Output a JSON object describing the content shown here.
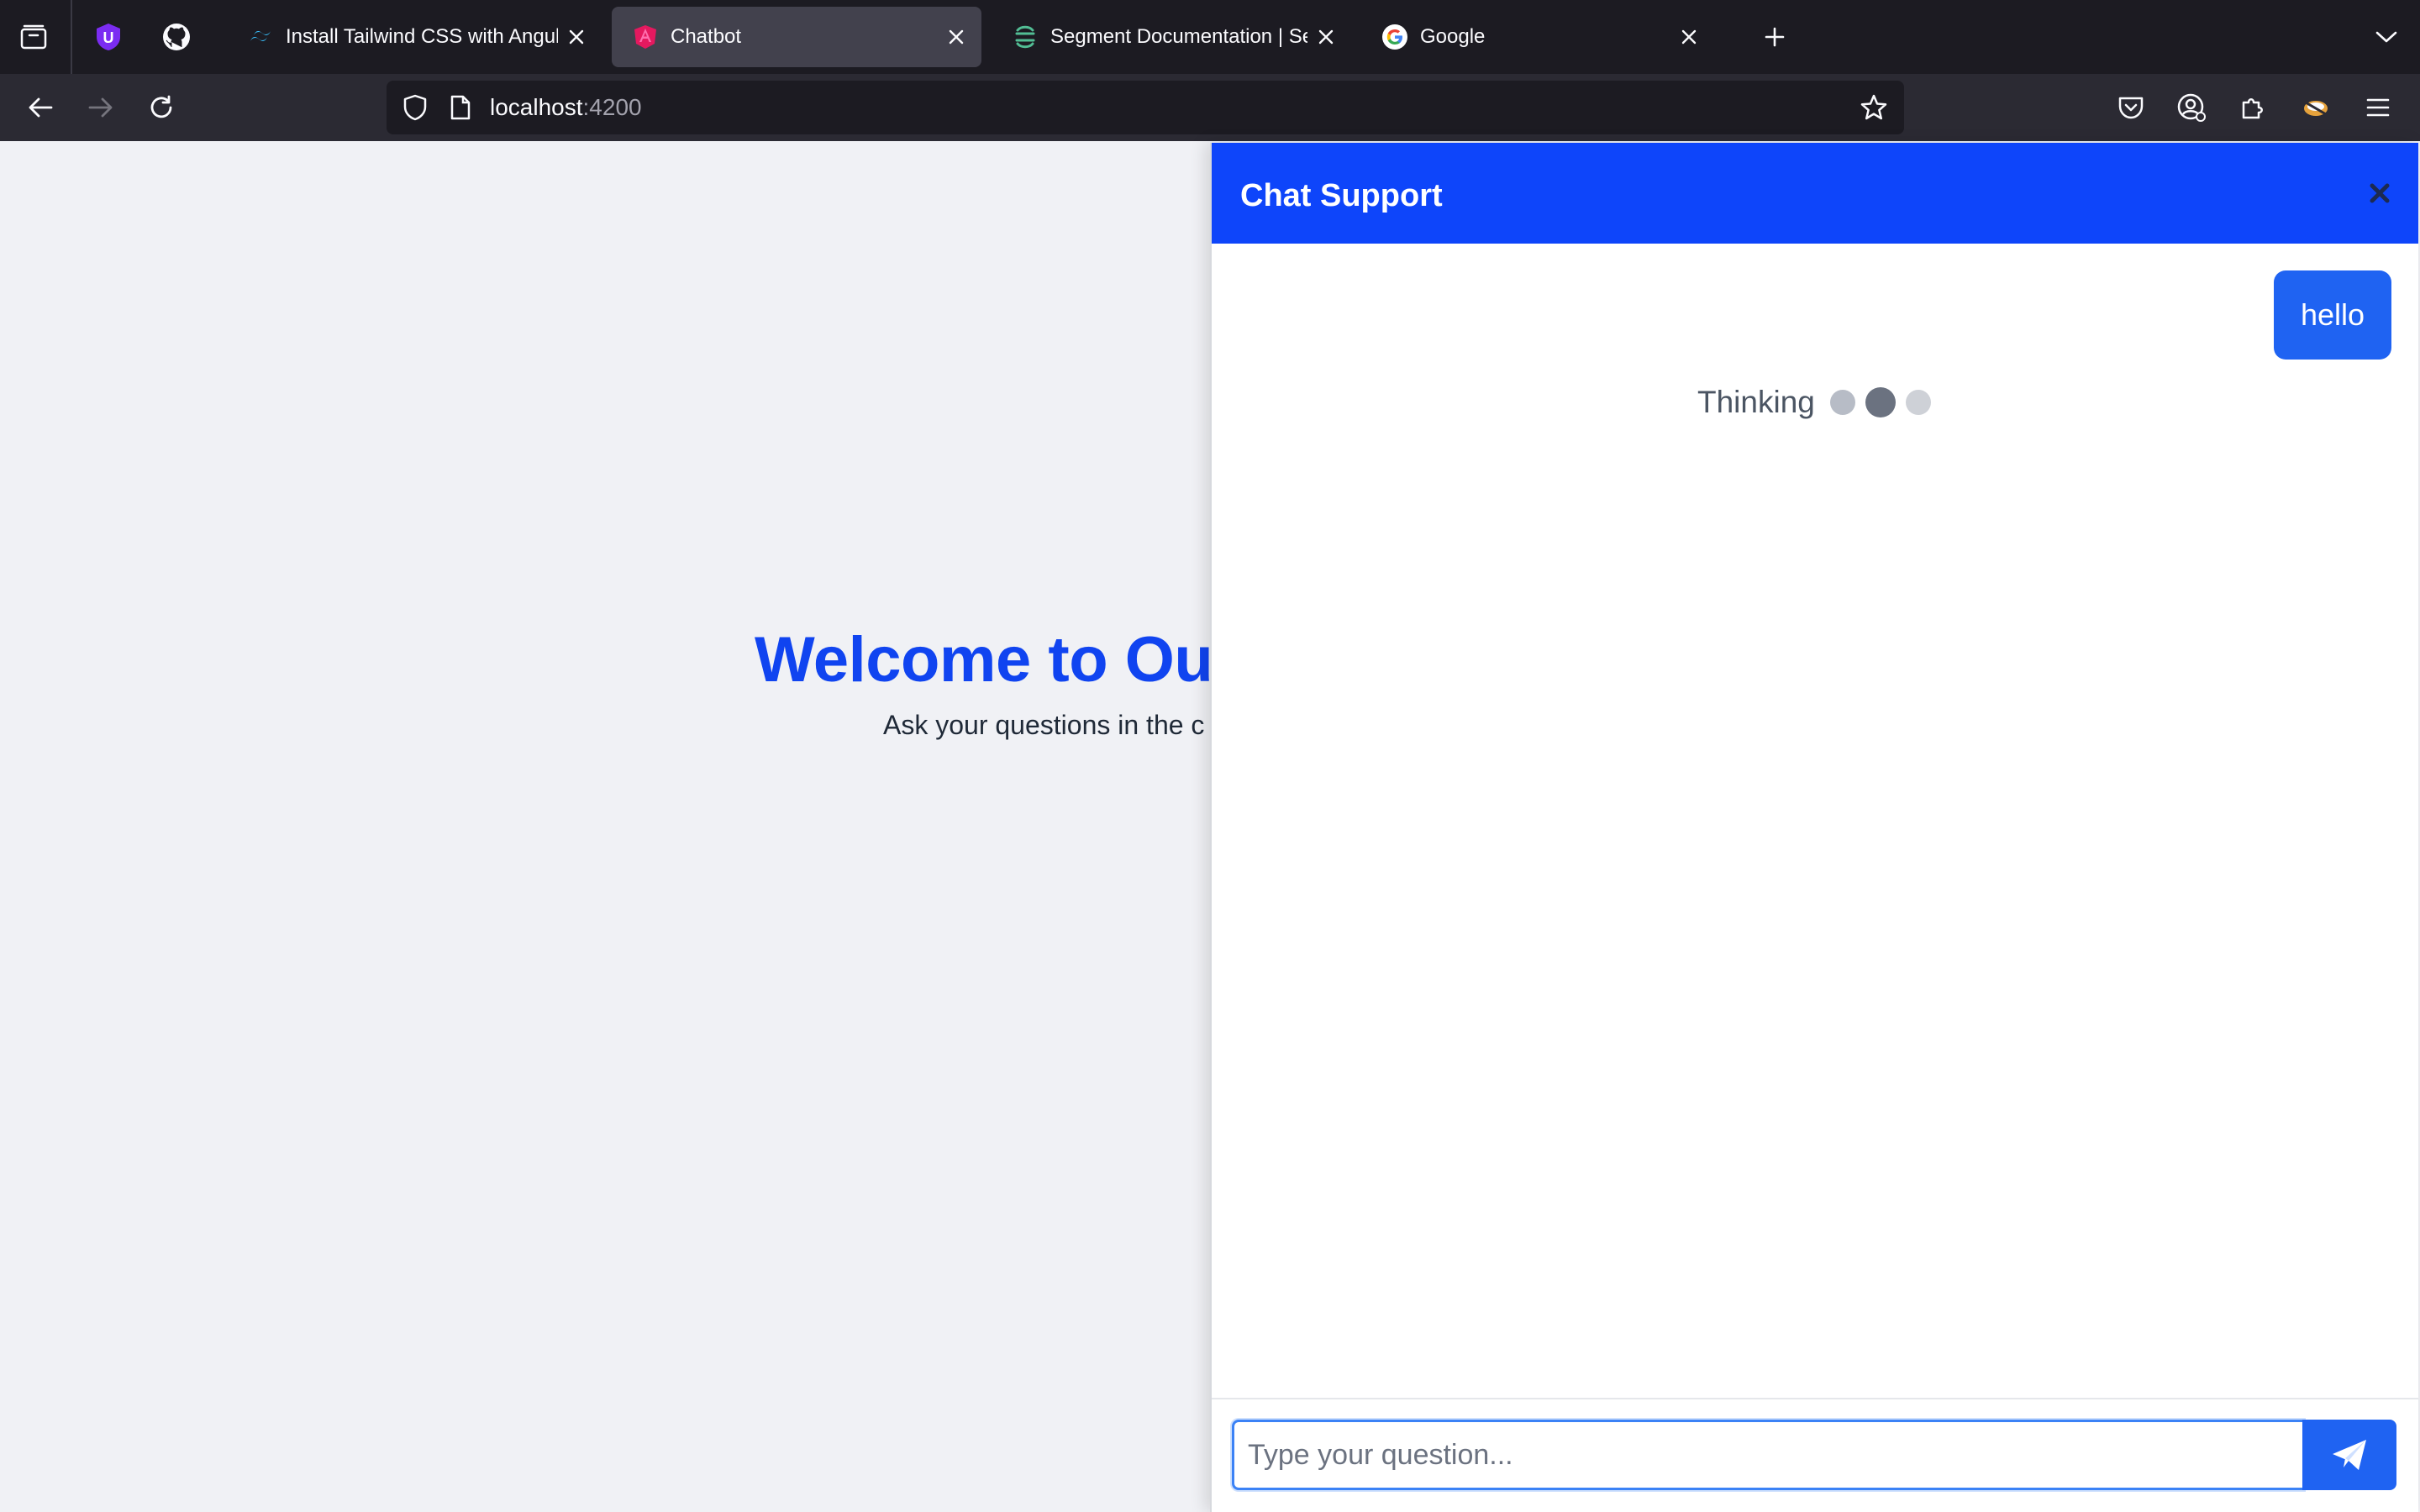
{
  "browser": {
    "tabs": [
      {
        "title": "Install Tailwind CSS with Angular",
        "favicon": "tailwind-icon",
        "active": false
      },
      {
        "title": "Chatbot",
        "favicon": "angular-icon",
        "active": true
      },
      {
        "title": "Segment Documentation | Segment",
        "favicon": "segment-icon",
        "active": false
      },
      {
        "title": "Google",
        "favicon": "google-icon",
        "active": false
      }
    ],
    "pinned_tabs": [
      "ublock-icon",
      "github-icon"
    ],
    "url": {
      "host": "localhost",
      "port": ":4200"
    }
  },
  "page": {
    "hero_title": "Welcome to Our",
    "hero_subtitle": "Ask your questions in the c"
  },
  "chat": {
    "title": "Chat Support",
    "messages": [
      {
        "role": "user",
        "text": "hello"
      }
    ],
    "thinking_label": "Thinking",
    "input_placeholder": "Type your question...",
    "accent_color": "#0e45fa"
  }
}
